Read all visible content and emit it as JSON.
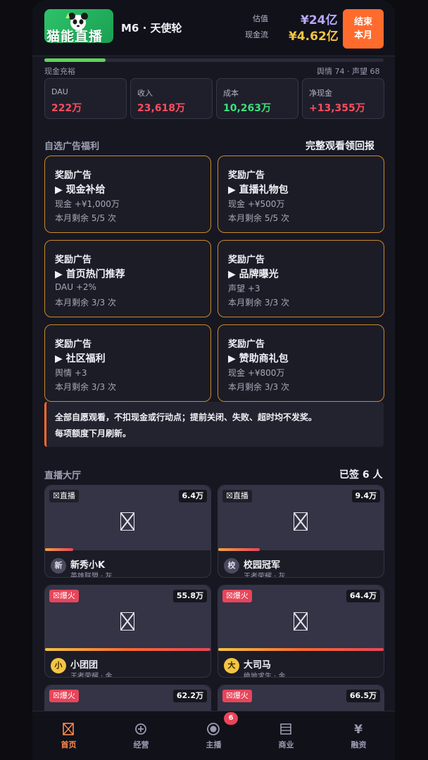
{
  "header": {
    "logo_text": "猫能直播",
    "month_label": "M6 · 天使轮",
    "valuation_label": "估值",
    "valuation_value": "¥24亿",
    "cashflow_label": "现金流",
    "cashflow_value": "¥4.62亿",
    "end_button_line1": "结束",
    "end_button_line2": "本月"
  },
  "status": {
    "cash_status": "现金充裕",
    "sentiment_reputation": "舆情 74 · 声望 68",
    "cash_level_percent": 18
  },
  "stats": [
    {
      "label": "DAU",
      "value": "222万",
      "color": "#ff4d5e"
    },
    {
      "label": "收入",
      "value": "23,618万",
      "color": "#ff4d5e"
    },
    {
      "label": "成本",
      "value": "10,263万",
      "color": "#3ee07a"
    },
    {
      "label": "净现金",
      "value": "+13,355万",
      "color": "#ff4d5e"
    }
  ],
  "ads_section": {
    "title": "自选广告福利",
    "right_text": "完整观看领回报",
    "items": [
      {
        "tag": "奖励广告",
        "name": "▶ 现金补给",
        "reward": "现金 +¥1,000万",
        "remaining": "本月剩余 5/5 次"
      },
      {
        "tag": "奖励广告",
        "name": "▶ 直播礼物包",
        "reward": "现金 +¥500万",
        "remaining": "本月剩余 5/5 次"
      },
      {
        "tag": "奖励广告",
        "name": "▶ 首页热门推荐",
        "reward": "DAU +2%",
        "remaining": "本月剩余 3/3 次"
      },
      {
        "tag": "奖励广告",
        "name": "▶ 品牌曝光",
        "reward": "声望 +3",
        "remaining": "本月剩余 3/3 次"
      },
      {
        "tag": "奖励广告",
        "name": "▶ 社区福利",
        "reward": "舆情 +3",
        "remaining": "本月剩余 3/3 次"
      },
      {
        "tag": "奖励广告",
        "name": "▶ 赞助商礼包",
        "reward": "现金 +¥800万",
        "remaining": "本月剩余 3/3 次"
      }
    ],
    "notice_line1": "全部自愿观看，不扣现金或行动点；提前关闭、失败、超时均不发奖。",
    "notice_line2": "每项额度下月刷新。"
  },
  "lobby": {
    "title": "直播大厅",
    "signed_count": "已签 6 人",
    "streamers": [
      {
        "tag": "直播",
        "hot": false,
        "viewers": "6.4万",
        "avatar": "新",
        "name": "新秀小K",
        "meta": "英雄联盟 · 灰",
        "heat_percent": 17,
        "avatar_bg": "#4a4a5e",
        "avatar_fg": "#e0e0ea"
      },
      {
        "tag": "直播",
        "hot": false,
        "viewers": "9.4万",
        "avatar": "校",
        "name": "校园冠军",
        "meta": "王者荣耀 · 灰",
        "heat_percent": 25,
        "avatar_bg": "#4a4a5e",
        "avatar_fg": "#e0e0ea"
      },
      {
        "tag": "爆火",
        "hot": true,
        "viewers": "55.8万",
        "avatar": "小",
        "name": "小团团",
        "meta": "王者荣耀 · 金",
        "heat_percent": 100,
        "avatar_bg": "#f5c542",
        "avatar_fg": "#3a2a00"
      },
      {
        "tag": "爆火",
        "hot": true,
        "viewers": "64.4万",
        "avatar": "大",
        "name": "大司马",
        "meta": "绝地求生 · 金",
        "heat_percent": 100,
        "avatar_bg": "#f5c542",
        "avatar_fg": "#3a2a00"
      },
      {
        "tag": "爆火",
        "hot": true,
        "viewers": "62.2万",
        "avatar": "",
        "name": "",
        "meta": "",
        "heat_percent": 100,
        "avatar_bg": "#f5c542",
        "avatar_fg": "#3a2a00"
      },
      {
        "tag": "爆火",
        "hot": true,
        "viewers": "66.5万",
        "avatar": "",
        "name": "",
        "meta": "",
        "heat_percent": 100,
        "avatar_bg": "#f5c542",
        "avatar_fg": "#3a2a00"
      }
    ]
  },
  "nav": {
    "items": [
      {
        "label": "首页",
        "icon": "home-icon",
        "active": true
      },
      {
        "label": "经营",
        "icon": "operations-icon",
        "active": false
      },
      {
        "label": "主播",
        "icon": "streamer-icon",
        "active": false
      },
      {
        "label": "商业",
        "icon": "business-icon",
        "active": false
      },
      {
        "label": "融资",
        "icon": "financing-icon",
        "active": false
      }
    ],
    "streamer_badge": "6"
  },
  "colors": {
    "accent": "#ff6b2c",
    "valuation": "#b9a8ff",
    "cashflow": "#f5c542",
    "ad_border": "#c78a2a",
    "hot_tag": "#e8455a"
  }
}
